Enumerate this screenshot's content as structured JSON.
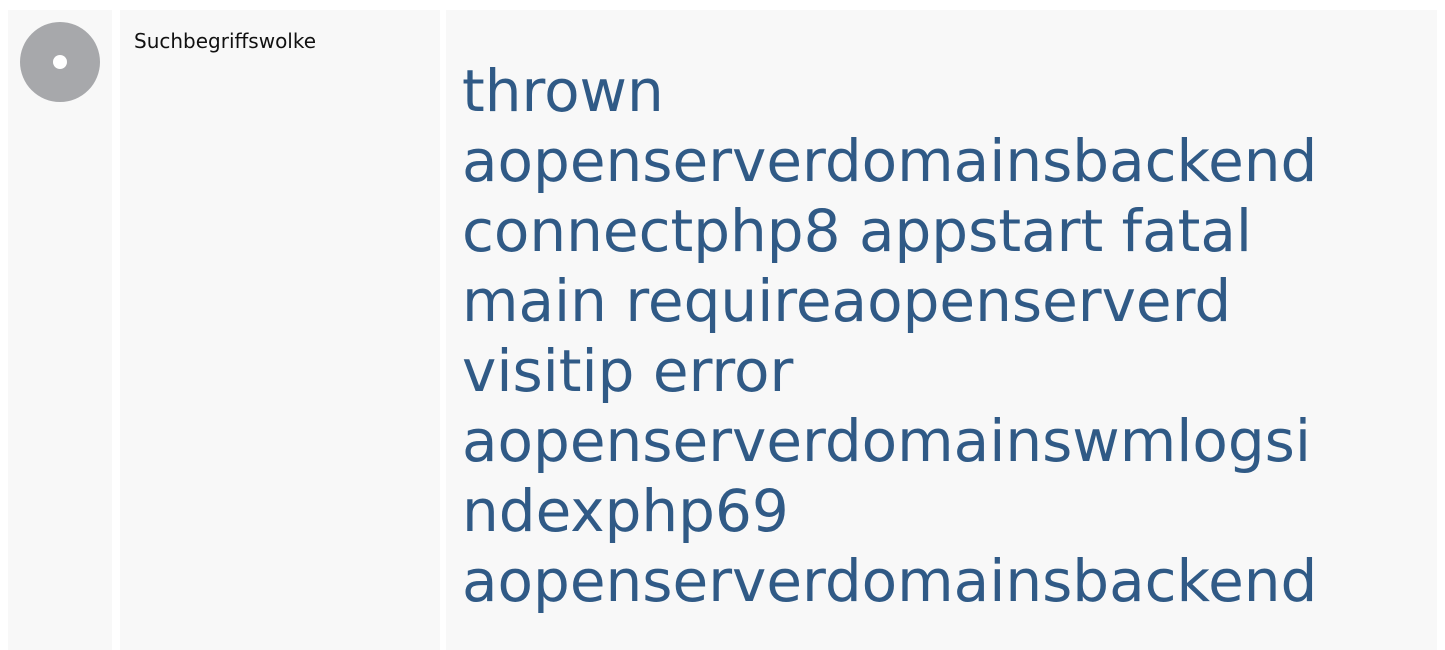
{
  "section": {
    "label": "Suchbegriffswolke",
    "icon": "circle-dot-icon"
  },
  "cloud": {
    "lines": [
      [
        "thrown"
      ],
      [
        "aopenserverdomainsbackend"
      ],
      [
        "connectphp8",
        "appstart",
        "fatal"
      ],
      [
        "main",
        "requireaopenserverd"
      ],
      [
        "visitip",
        "error"
      ],
      [
        "aopenserverdomainswmlogsi"
      ],
      [
        "ndexphp69"
      ],
      [
        "aopenserverdomainsbackend"
      ]
    ]
  },
  "colors": {
    "panel": "#f8f8f8",
    "icon": "#a7a8ab",
    "cloud_text": "#305a86"
  }
}
